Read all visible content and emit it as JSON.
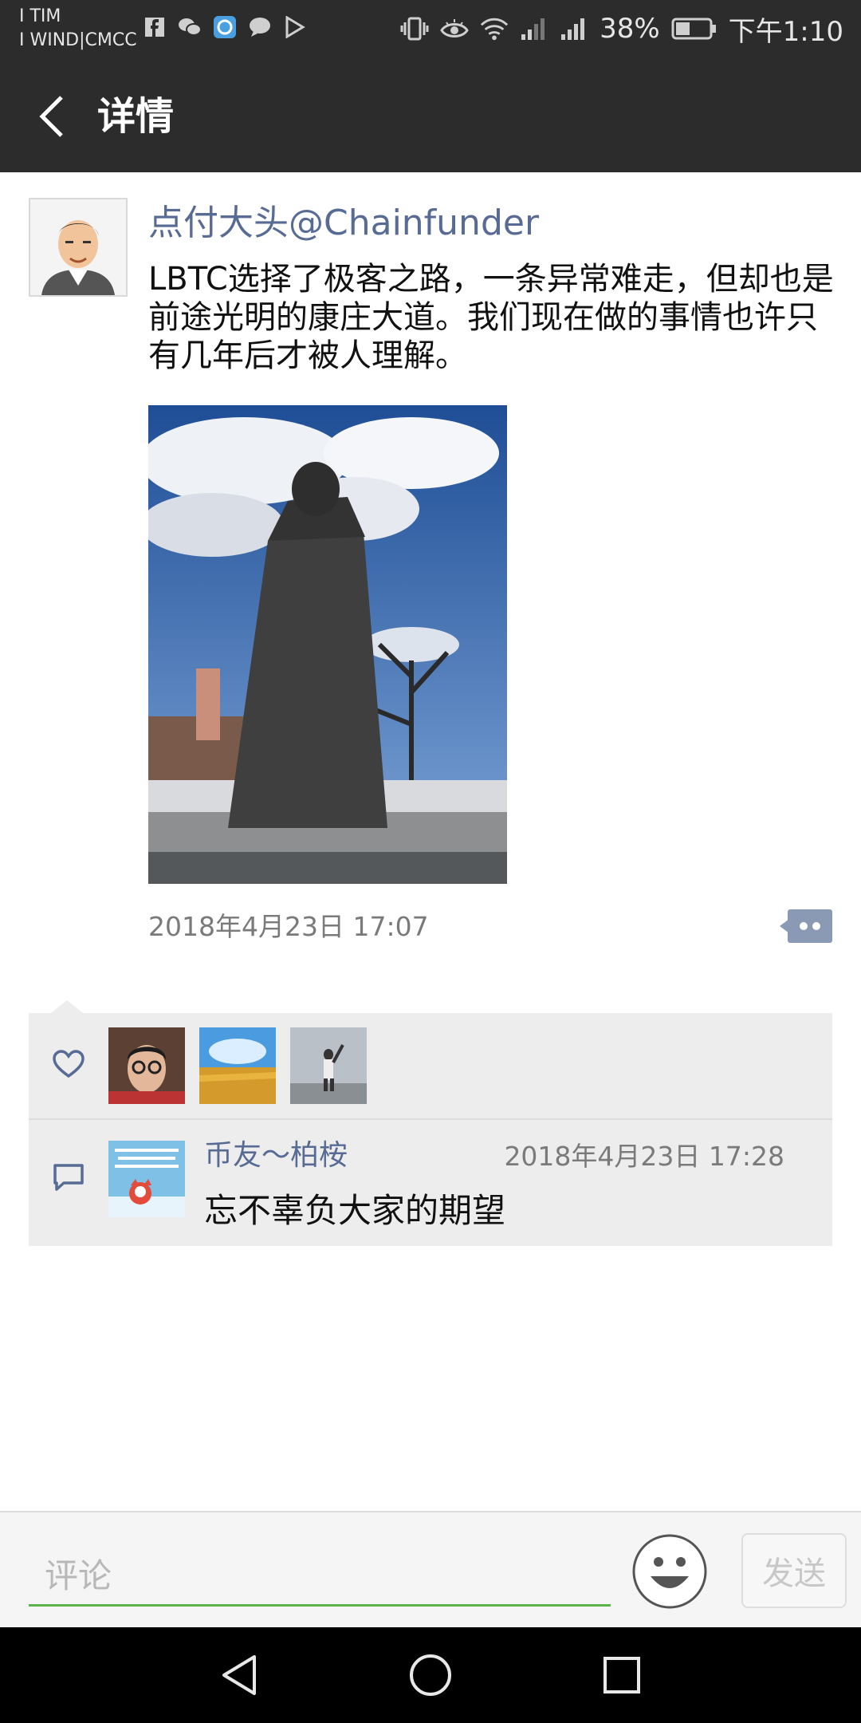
{
  "status_bar": {
    "carrier1": "I TIM",
    "carrier2": "I WIND|CMCC",
    "battery": "38%",
    "time": "下午1:10"
  },
  "header": {
    "title": "详情"
  },
  "post": {
    "author": "点付大头@Chainfunder",
    "text": "LBTC选择了极客之路，一条异常难走，但却也是前途光明的康庄大道。我们现在做的事情也许只有几年后才被人理解。",
    "date": "2018年4月23日 17:07"
  },
  "comment": {
    "author": "币友～柏桉",
    "time": "2018年4月23日 17:28",
    "text": "忘不辜负大家的期望"
  },
  "input": {
    "placeholder": "评论",
    "send_label": "发送"
  }
}
